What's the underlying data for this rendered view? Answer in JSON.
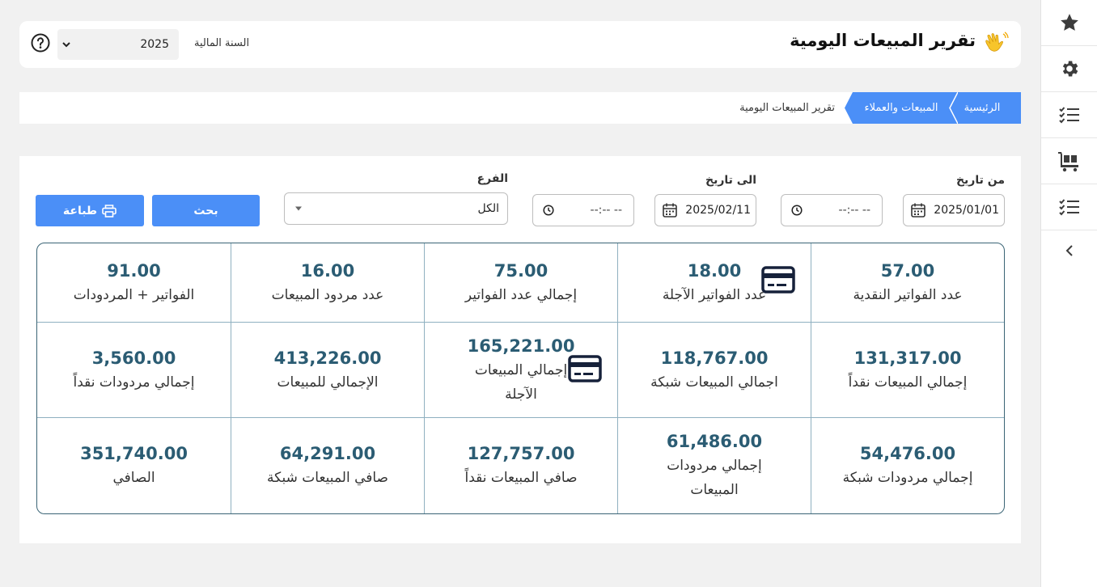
{
  "header": {
    "title": "تقرير المبيعات اليومية",
    "fiscal_year_label": "السنة المالية",
    "fiscal_year_value": "2025"
  },
  "breadcrumb": {
    "home": "الرئيسية",
    "section": "المبيعات والعملاء",
    "current": "تقرير المبيعات اليومية"
  },
  "filters": {
    "from_date_label": "من تاريخ",
    "from_date_value": "2025/01/01",
    "from_time_value": "--:-- --",
    "to_date_label": "الى تاريخ",
    "to_date_value": "2025/02/11",
    "to_time_value": "--:-- --",
    "branch_label": "الفرع",
    "branch_value": "الكل",
    "search_button": "بحث",
    "print_button": "طباعة"
  },
  "stats": {
    "cash_invoices_count": {
      "value": "57.00",
      "label": "عدد الفواتير النقدية"
    },
    "credit_invoices_count": {
      "value": "18.00",
      "label": "عدد الفواتير الآجلة"
    },
    "total_invoices_count": {
      "value": "75.00",
      "label": "إجمالي عدد الفواتير"
    },
    "sales_returns_count": {
      "value": "16.00",
      "label": "عدد مردود المبيعات"
    },
    "invoices_plus_returns": {
      "value": "91.00",
      "label": "الفواتير + المردودات"
    },
    "total_cash_sales": {
      "value": "131,317.00",
      "label": "إجمالي المبيعات نقداً"
    },
    "total_network_sales": {
      "value": "118,767.00",
      "label": "اجمالي المبيعات شبكة"
    },
    "total_credit_sales": {
      "value": "165,221.00",
      "label_line1": "إجمالي المبيعات",
      "label_line2": "الآجلة"
    },
    "total_sales": {
      "value": "413,226.00",
      "label": "الإجمالي للمبيعات"
    },
    "total_cash_returns": {
      "value": "3,560.00",
      "label": "إجمالي مردودات نقداً"
    },
    "total_network_returns": {
      "value": "54,476.00",
      "label": "إجمالي مردودات شبكة"
    },
    "total_sales_returns": {
      "value": "61,486.00",
      "label_line1": "إجمالي مردودات",
      "label_line2": "المبيعات"
    },
    "net_cash_sales": {
      "value": "127,757.00",
      "label": "صافي المبيعات نقداً"
    },
    "net_network_sales": {
      "value": "64,291.00",
      "label": "صافي المبيعات شبكة"
    },
    "net": {
      "value": "351,740.00",
      "label": "الصافي"
    }
  },
  "icons": {
    "sidebar": [
      "star-icon",
      "gear-icon",
      "checklist-icon",
      "cart-icon",
      "checklist-icon",
      "chevron-left-icon"
    ],
    "header": [
      "waving-hand-icon",
      "help-icon",
      "chevron-down-icon"
    ],
    "cells": [
      "credit-card-icon"
    ]
  },
  "colors": {
    "accent": "#4b8ff7",
    "value_text": "#2b5c73",
    "grid_border": "#3a6475"
  }
}
